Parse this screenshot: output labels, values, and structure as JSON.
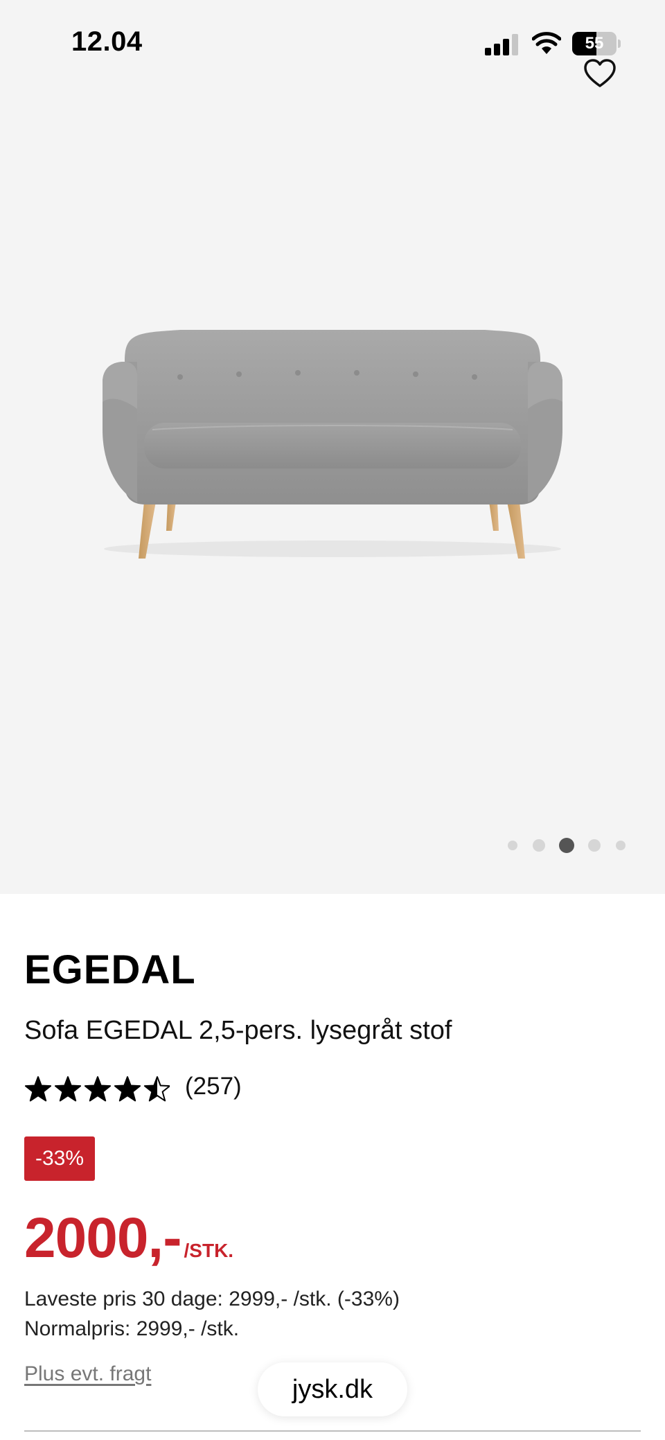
{
  "status_bar": {
    "time": "12.04",
    "battery_level": "55",
    "battery_fraction": 0.55,
    "icons": [
      "cellular-signal-icon",
      "wifi-icon",
      "battery-icon"
    ]
  },
  "hero": {
    "wishlist_icon": "heart-outline-icon",
    "image_alt": "grey sofa with wooden legs",
    "carousel": {
      "count": 5,
      "active_index": 2
    }
  },
  "product": {
    "brand": "EGEDAL",
    "name": "Sofa EGEDAL 2,5-pers. lysegråt stof",
    "rating": {
      "value": 4.5,
      "max": 5,
      "review_count": "(257)"
    },
    "discount_badge": "-33%",
    "price": "2000,-",
    "price_unit": "/STK.",
    "lowest_price_note": "Laveste pris 30 dage: 2999,- /stk. (-33%)",
    "normal_price_note": "Normalpris: 2999,- /stk.",
    "freight_link": "Plus evt. fragt"
  },
  "browser": {
    "url": "jysk.dk"
  },
  "colors": {
    "accent_red": "#c8232c",
    "hero_bg": "#f4f4f4",
    "dot_active": "#555555",
    "dot_inactive": "#d6d6d6"
  }
}
